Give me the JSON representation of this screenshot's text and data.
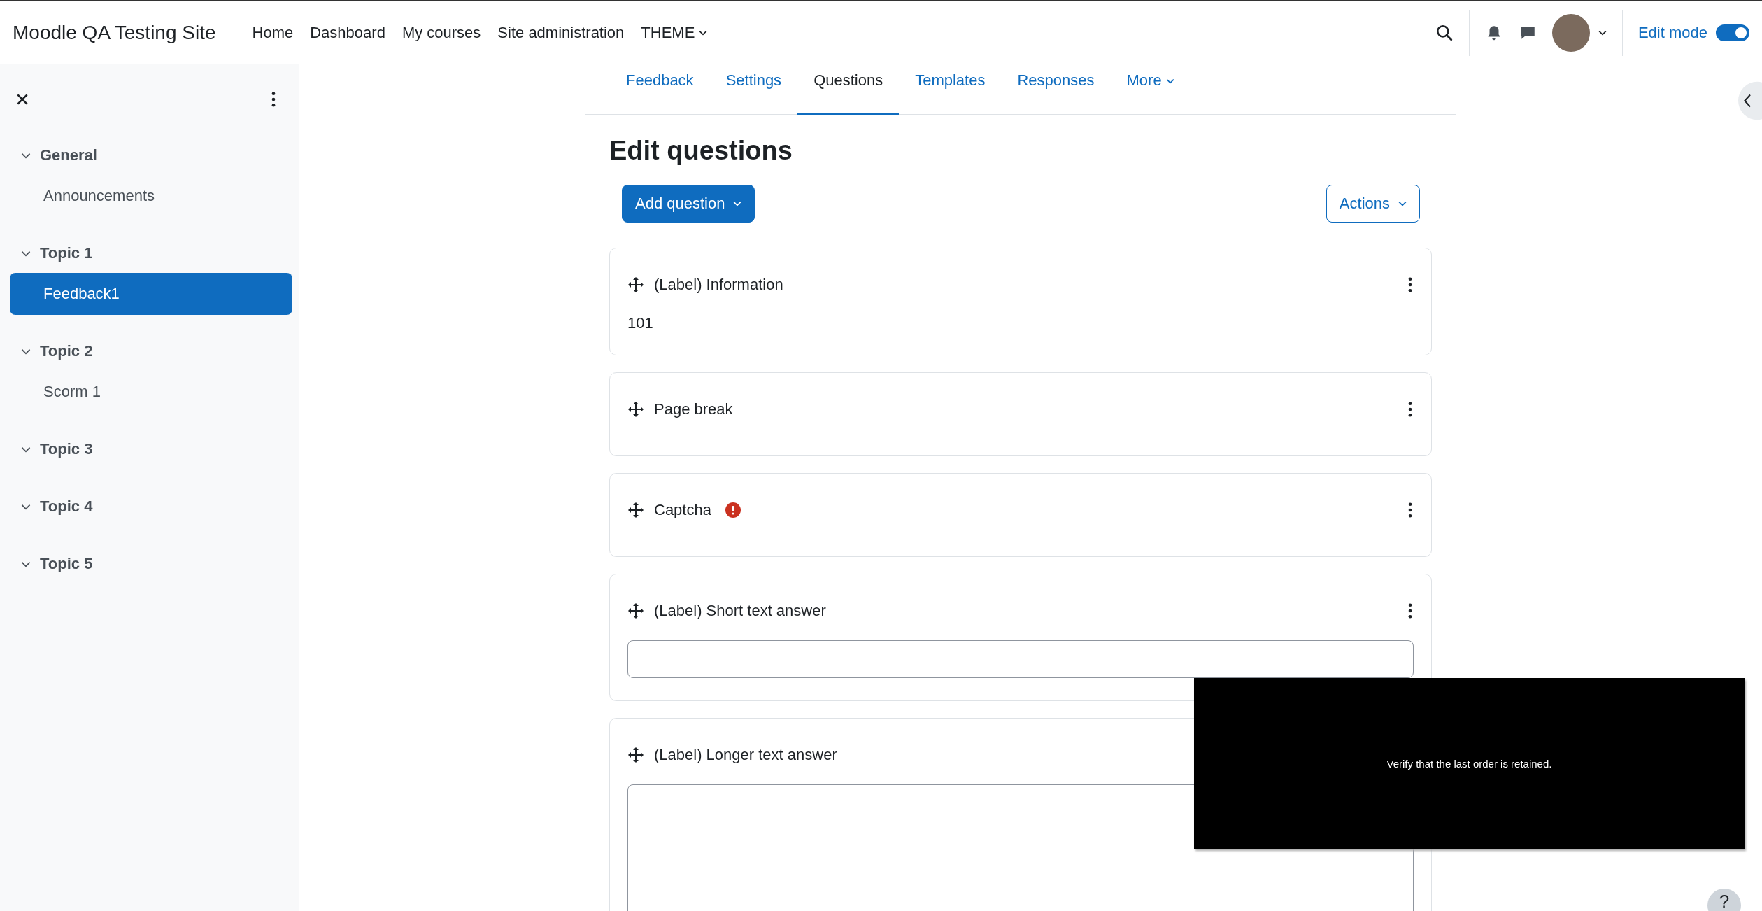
{
  "header": {
    "site_name": "Moodle QA Testing Site",
    "nav": [
      {
        "label": "Home",
        "dropdown": false
      },
      {
        "label": "Dashboard",
        "dropdown": false
      },
      {
        "label": "My courses",
        "dropdown": false
      },
      {
        "label": "Site administration",
        "dropdown": false
      },
      {
        "label": "THEME",
        "dropdown": true
      }
    ],
    "edit_mode": {
      "label": "Edit mode",
      "on": true
    }
  },
  "sidebar": {
    "sections": [
      {
        "title": "General",
        "expanded": true,
        "items": [
          {
            "label": "Announcements",
            "selected": false
          }
        ]
      },
      {
        "title": "Topic 1",
        "expanded": true,
        "items": [
          {
            "label": "Feedback1",
            "selected": true
          }
        ]
      },
      {
        "title": "Topic 2",
        "expanded": true,
        "items": [
          {
            "label": "Scorm 1",
            "selected": false
          }
        ]
      },
      {
        "title": "Topic 3",
        "expanded": true
      },
      {
        "title": "Topic 4",
        "expanded": true
      },
      {
        "title": "Topic 5",
        "expanded": true
      }
    ]
  },
  "tabs": [
    {
      "label": "Feedback",
      "selected": false,
      "dropdown": false
    },
    {
      "label": "Settings",
      "selected": false,
      "dropdown": false
    },
    {
      "label": "Questions",
      "selected": true,
      "dropdown": false
    },
    {
      "label": "Templates",
      "selected": false,
      "dropdown": false
    },
    {
      "label": "Responses",
      "selected": false,
      "dropdown": false
    },
    {
      "label": "More",
      "selected": false,
      "dropdown": true
    }
  ],
  "heading": "Edit questions",
  "add_button": "Add question",
  "actions_button": "Actions",
  "questions": [
    {
      "kind": "label",
      "title": "(Label) Information",
      "body": "101",
      "warning": false,
      "menu": true
    },
    {
      "kind": "pagebreak",
      "title": "Page break",
      "warning": false,
      "menu": true
    },
    {
      "kind": "captcha",
      "title": "Captcha",
      "warning": true,
      "menu": true
    },
    {
      "kind": "textfield",
      "title": "(Label) Short text answer",
      "warning": false,
      "menu": true
    },
    {
      "kind": "textarea",
      "title": "(Label) Longer text answer",
      "warning": false
    }
  ],
  "overlay": {
    "caption": "Verify that the last order is retained."
  },
  "help_button": "?"
}
